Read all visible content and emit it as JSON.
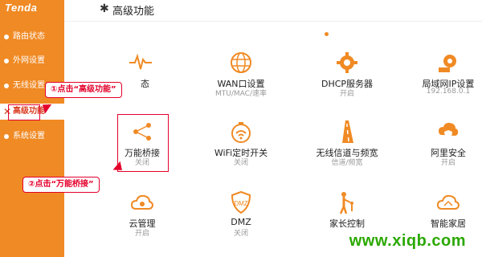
{
  "brand": "Tenda",
  "sidebar": {
    "items": [
      {
        "label": "路由状态"
      },
      {
        "label": "外网设置"
      },
      {
        "label": "无线设置"
      },
      {
        "label": "高级功能"
      },
      {
        "label": "系统设置"
      }
    ],
    "active_icon": "✕"
  },
  "header": {
    "title": "高级功能",
    "icon": "wrench-icon"
  },
  "tiles": [
    {
      "label": "",
      "sub": "",
      "icon": "traffic-pulse-icon"
    },
    {
      "label": "WAN口设置",
      "sub": "MTU/MAC/速率",
      "icon": "globe-icon"
    },
    {
      "label": "DHCP服务器",
      "sub": "开启",
      "icon": "dhcp-gear-icon"
    },
    {
      "label": "局域网IP设置",
      "sub": "192.168.0.1",
      "icon": "lan-ip-gear-icon"
    },
    {
      "label": "万能桥接",
      "sub": "关闭",
      "icon": "bridge-share-icon"
    },
    {
      "label": "WiFi定时开关",
      "sub": "关闭",
      "icon": "wifi-timer-icon"
    },
    {
      "label": "无线信道与频宽",
      "sub": "信道/频宽",
      "icon": "channel-road-icon"
    },
    {
      "label": "阿里安全",
      "sub": "开启",
      "icon": "shield-cloud-icon"
    },
    {
      "label": "云管理",
      "sub": "开启",
      "icon": "cloud-gear-icon"
    },
    {
      "label": "DMZ",
      "sub": "关闭",
      "icon": "dmz-shield-icon"
    },
    {
      "label": "家长控制",
      "sub": "",
      "icon": "parent-child-icon"
    },
    {
      "label": "智能家居",
      "sub": "",
      "icon": "smart-home-icon"
    }
  ],
  "partial_label_fragment": "态",
  "callouts": {
    "step1": "①点击“高级功能”",
    "step2": "②点击“万能桥接”"
  },
  "watermark": "www.xiqb.com",
  "colors": {
    "accent": "#f08a24",
    "highlight": "#e4002b",
    "watermark": "#2aa800"
  }
}
